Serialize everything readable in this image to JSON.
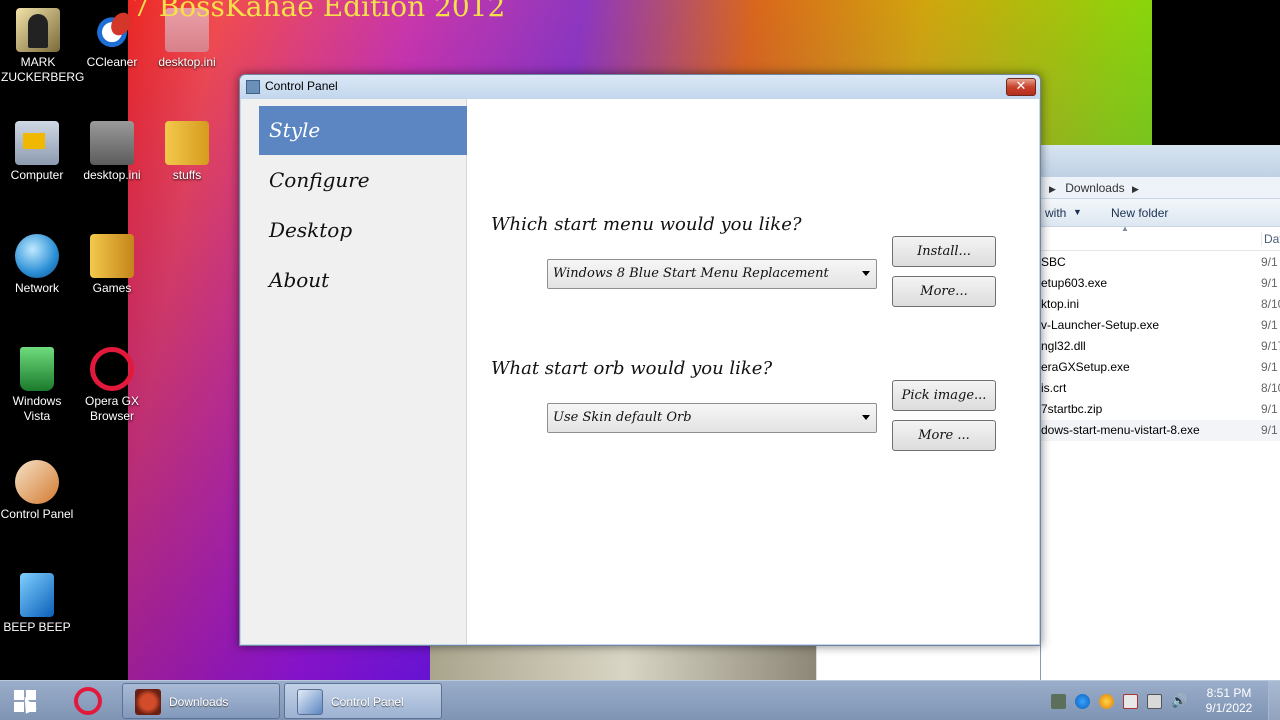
{
  "wallpaper": {
    "title": "7 BossKahae Edition 2012"
  },
  "desktop_icons": [
    {
      "label": "MARK ZUCKERBERG",
      "icon": "folder-person-icon"
    },
    {
      "label": "CCleaner",
      "icon": "ccleaner-icon"
    },
    {
      "label": "desktop.ini",
      "icon": "ini-file-icon"
    },
    {
      "label": "Computer",
      "icon": "computer-icon"
    },
    {
      "label": "desktop.ini",
      "icon": "ini-file-icon"
    },
    {
      "label": "stuffs",
      "icon": "folder-icon"
    },
    {
      "label": "Network",
      "icon": "network-globe-icon"
    },
    {
      "label": "Games",
      "icon": "games-folder-icon"
    },
    {
      "label": "Windows Vista",
      "icon": "recycle-bin-icon"
    },
    {
      "label": "Opera GX Browser",
      "icon": "opera-gx-icon"
    },
    {
      "label": "Control Panel",
      "icon": "control-panel-icon"
    },
    {
      "label": "BEEP BEEP",
      "icon": "blue-file-icon"
    }
  ],
  "explorer": {
    "breadcrumb": "Downloads",
    "toolbar": {
      "open_with": "with",
      "new_folder": "New folder"
    },
    "column_header": "Dat",
    "files": [
      {
        "name": "SBC",
        "date": "9/1"
      },
      {
        "name": "etup603.exe",
        "date": "9/1"
      },
      {
        "name": "ktop.ini",
        "date": "8/10"
      },
      {
        "name": "v-Launcher-Setup.exe",
        "date": "9/1"
      },
      {
        "name": "ngl32.dll",
        "date": "9/17"
      },
      {
        "name": "eraGXSetup.exe",
        "date": "9/1"
      },
      {
        "name": "is.crt",
        "date": "8/10"
      },
      {
        "name": "7startbc.zip",
        "date": "9/1"
      },
      {
        "name": "dows-start-menu-vistart-8.exe",
        "date": "9/1"
      }
    ]
  },
  "control_panel": {
    "title": "Control Panel",
    "close_label": "✕",
    "sidebar": [
      {
        "label": "Style",
        "active": true
      },
      {
        "label": "Configure",
        "active": false
      },
      {
        "label": "Desktop",
        "active": false
      },
      {
        "label": "About",
        "active": false
      }
    ],
    "start_menu": {
      "question": "Which start menu would you like?",
      "selected": "Windows 8 Blue Start Menu Replacement",
      "install_label": "Install...",
      "more_label": "More..."
    },
    "start_orb": {
      "question": "What start orb would you like?",
      "selected": "Use Skin default Orb",
      "pick_label": "Pick image...",
      "more_label": "More ..."
    }
  },
  "taskbar": {
    "tasks": [
      {
        "label": "Downloads"
      },
      {
        "label": "Control Panel"
      }
    ],
    "clock": {
      "time": "8:51 PM",
      "date": "9/1/2022"
    }
  },
  "colors": {
    "sidebar_active": "#5b86c1",
    "taskbar": "#8fa3c3",
    "close_button": "#c7412b"
  }
}
